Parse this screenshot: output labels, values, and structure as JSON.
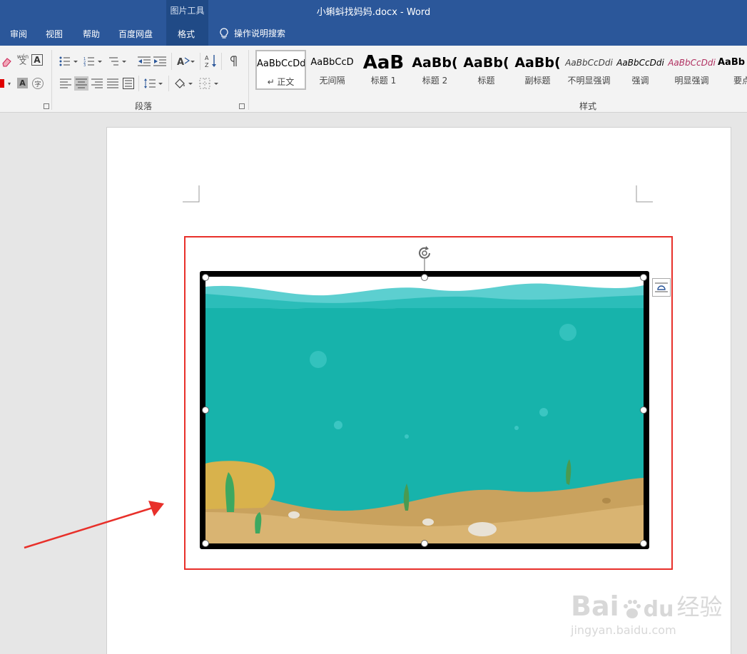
{
  "window": {
    "title": "小蝌蚪找妈妈.docx - Word",
    "context_group": "图片工具"
  },
  "tabs": [
    "审阅",
    "视图",
    "帮助",
    "百度网盘",
    "格式"
  ],
  "tell_me": {
    "label": "操作说明搜索"
  },
  "ribbon": {
    "paragraph_group_label": "段落",
    "styles_group_label": "样式",
    "styles": [
      {
        "sample": "AaBbCcDd",
        "name": "↵ 正文"
      },
      {
        "sample": "AaBbCcD",
        "name": "无间隔"
      },
      {
        "sample": "AaB",
        "name": "标题 1"
      },
      {
        "sample": "AaBb(",
        "name": "标题 2"
      },
      {
        "sample": "AaBb(",
        "name": "标题"
      },
      {
        "sample": "AaBb(",
        "name": "副标题"
      },
      {
        "sample": "AaBbCcDdi",
        "name": "不明显强调"
      },
      {
        "sample": "AaBbCcDdi",
        "name": "强调"
      },
      {
        "sample": "AaBbCcDdi",
        "name": "明显强调"
      },
      {
        "sample": "AaBb",
        "name": "要点"
      }
    ],
    "font_tools": {
      "phonetic_top": "wén",
      "phonetic_bottom": "文",
      "border_char": "A",
      "shade_char": "A",
      "enclose_char": "字"
    }
  },
  "watermark": {
    "brand": "Bai",
    "brand2": "du",
    "brand_cn": "经验",
    "url": "jingyan.baidu.com"
  },
  "colors": {
    "title_bar": "#2b579a",
    "selection_box": "#e8302a",
    "arrow": "#e8302a",
    "water": "#17b3ab",
    "sand": "#c9a25e"
  }
}
